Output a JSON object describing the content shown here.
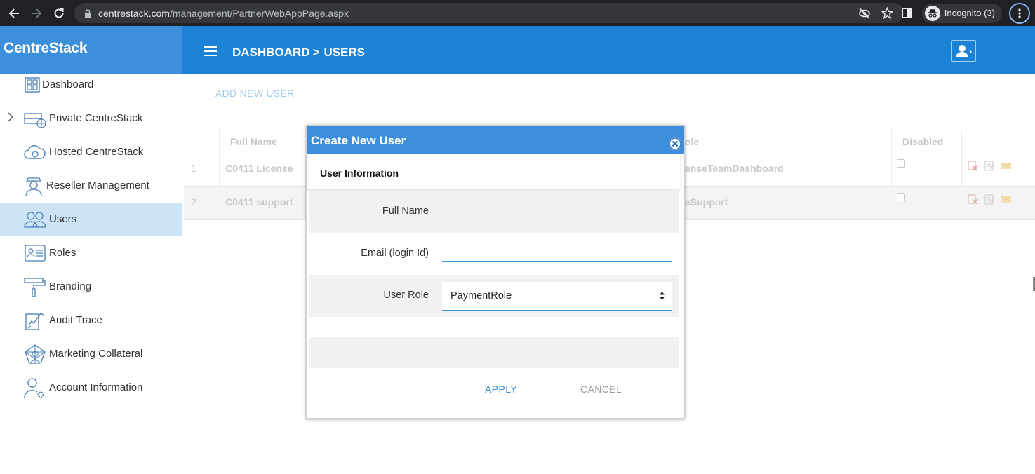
{
  "browser": {
    "url_host": "centrestack.com",
    "url_path": "/management/PartnerWebAppPage.aspx",
    "incognito_label": "Incognito (3)"
  },
  "sidebar": {
    "brand": "CentreStack",
    "items": [
      {
        "label": "Dashboard",
        "icon": "dashboard-icon"
      },
      {
        "label": "Private CentreStack",
        "icon": "server-globe-icon"
      },
      {
        "label": "Hosted CentreStack",
        "icon": "cloud-icon"
      },
      {
        "label": "Reseller Management",
        "icon": "reseller-icon"
      },
      {
        "label": "Users",
        "icon": "users-icon"
      },
      {
        "label": "Roles",
        "icon": "id-card-icon"
      },
      {
        "label": "Branding",
        "icon": "paint-roller-icon"
      },
      {
        "label": "Audit Trace",
        "icon": "audit-icon"
      },
      {
        "label": "Marketing Collateral",
        "icon": "network-icon"
      },
      {
        "label": "Account Information",
        "icon": "account-settings-icon"
      }
    ]
  },
  "header": {
    "crumb_1": "DASHBOARD",
    "crumb_sep": ">",
    "crumb_2": "USERS"
  },
  "toolbar": {
    "add_user_label": "ADD NEW USER"
  },
  "table": {
    "headers": {
      "full_name": "Full Name",
      "role": "ole",
      "disabled": "Disabled"
    },
    "rows": [
      {
        "index": "1",
        "full_name": "C0411 License",
        "role": "enseTeamDashboard"
      },
      {
        "index": "2",
        "full_name": "C0411 support",
        "role": "eSupport"
      }
    ]
  },
  "modal": {
    "title": "Create New User",
    "section": "User Information",
    "full_name_label": "Full Name",
    "full_name_value": "",
    "email_label": "Email (login Id)",
    "email_value": "",
    "role_label": "User Role",
    "role_value": "PaymentRole",
    "apply_label": "APPLY",
    "cancel_label": "CANCEL"
  },
  "colors": {
    "brand_blue": "#3b8fdb",
    "header_blue": "#1b82d6",
    "active_item": "#cde4f6"
  }
}
